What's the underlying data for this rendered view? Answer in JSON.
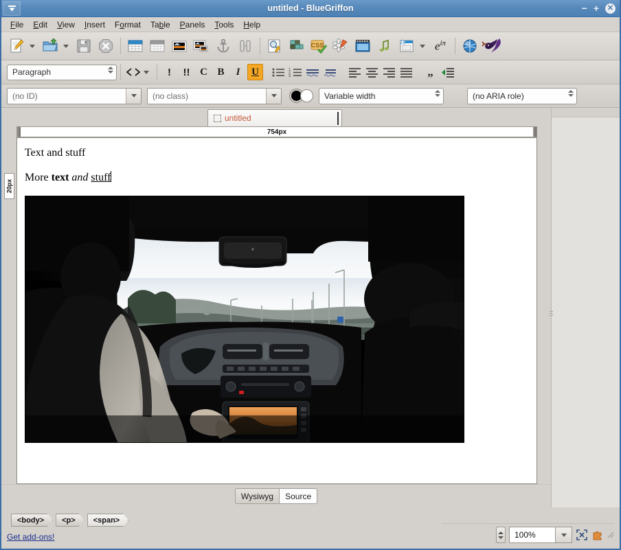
{
  "window": {
    "title": "untitled - BlueGriffon",
    "menu_icon": "window-menu-caret-icon",
    "minimize": "−",
    "maximize": "+",
    "close": "✕"
  },
  "menubar": {
    "items": [
      {
        "label": "File",
        "accel": "F"
      },
      {
        "label": "Edit",
        "accel": "E"
      },
      {
        "label": "View",
        "accel": "V"
      },
      {
        "label": "Insert",
        "accel": "I"
      },
      {
        "label": "Format",
        "accel": "o"
      },
      {
        "label": "Table",
        "accel": "b"
      },
      {
        "label": "Panels",
        "accel": "P"
      },
      {
        "label": "Tools",
        "accel": "T"
      },
      {
        "label": "Help",
        "accel": "H"
      }
    ]
  },
  "toolbar_main": {
    "items": [
      {
        "name": "new-document-icon",
        "kind": "button"
      },
      {
        "name": "new-document-dropdown-icon",
        "kind": "arrow"
      },
      {
        "name": "open-file-icon",
        "kind": "button"
      },
      {
        "name": "open-file-dropdown-icon",
        "kind": "arrow"
      },
      {
        "name": "save-icon",
        "kind": "button"
      },
      {
        "name": "cancel-icon",
        "kind": "button"
      },
      {
        "name": "insert-table-icon",
        "kind": "button"
      },
      {
        "name": "table-properties-icon",
        "kind": "button"
      },
      {
        "name": "insert-image-icon",
        "kind": "button"
      },
      {
        "name": "image-properties-icon",
        "kind": "button"
      },
      {
        "name": "anchor-icon",
        "kind": "button"
      },
      {
        "name": "link-icon",
        "kind": "button"
      },
      {
        "name": "preview-icon",
        "kind": "button"
      },
      {
        "name": "blocks-icon",
        "kind": "button"
      },
      {
        "name": "css-icon",
        "kind": "button"
      },
      {
        "name": "svg-icon",
        "kind": "button"
      },
      {
        "name": "video-icon",
        "kind": "button"
      },
      {
        "name": "audio-icon",
        "kind": "button"
      },
      {
        "name": "form-icon",
        "kind": "button"
      },
      {
        "name": "form-dropdown-icon",
        "kind": "arrow"
      },
      {
        "name": "math-icon",
        "kind": "button"
      },
      {
        "name": "browse-icon",
        "kind": "button"
      },
      {
        "name": "bluegriffon-logo-icon",
        "kind": "button"
      }
    ]
  },
  "toolbar_format": {
    "paragraph_style": "Paragraph",
    "buttons": [
      {
        "name": "code-tag-icon",
        "glyph": "‹›"
      },
      {
        "name": "code-tag-dropdown-icon",
        "glyph": ""
      },
      {
        "name": "emphasis-icon",
        "glyph": "!"
      },
      {
        "name": "strong-emphasis-icon",
        "glyph": "!!"
      },
      {
        "name": "cite-icon",
        "glyph": "C"
      },
      {
        "name": "bold-icon",
        "glyph": "B"
      },
      {
        "name": "italic-icon",
        "glyph": "I"
      },
      {
        "name": "underline-icon",
        "glyph": "U"
      },
      {
        "name": "bullet-list-icon",
        "glyph": ""
      },
      {
        "name": "numbered-list-icon",
        "glyph": ""
      },
      {
        "name": "outdent-icon",
        "glyph": ""
      },
      {
        "name": "indent-icon",
        "glyph": ""
      },
      {
        "name": "align-left-icon",
        "glyph": ""
      },
      {
        "name": "align-center-icon",
        "glyph": ""
      },
      {
        "name": "align-right-icon",
        "glyph": ""
      },
      {
        "name": "align-justify-icon",
        "glyph": ""
      },
      {
        "name": "blockquote-icon",
        "glyph": ""
      },
      {
        "name": "insert-indent-icon",
        "glyph": ""
      }
    ],
    "active_button": "underline-icon",
    "active_color": "#f5a623"
  },
  "toolbar_attrs": {
    "id_value": "(no ID)",
    "class_value": "(no class)",
    "foreground_color": "#000000",
    "background_color": "#ffffff",
    "font_value": "Variable width",
    "aria_value": "(no ARIA role)"
  },
  "document_tab": {
    "label": "untitled",
    "favicon": "blank-favicon-icon"
  },
  "rulers": {
    "horizontal_label": "754px",
    "vertical_label": "20px"
  },
  "content": {
    "paragraph1": "Text and stuff",
    "paragraph2": {
      "plain1": "More ",
      "bold": "text",
      "plain2": " ",
      "italic": "and",
      "plain3": " ",
      "underline": "stuff"
    },
    "image": {
      "name": "car-interior-photo",
      "description": "View from rear seat of a car through the windshield at a bright overcast sky over a highway"
    }
  },
  "view_tabs": {
    "wysiwyg": "Wysiwyg",
    "source": "Source",
    "active": "Source"
  },
  "breadcrumb": {
    "items": [
      "<body>",
      "<p>",
      "<span>"
    ]
  },
  "status": {
    "addons_link": "Get add-ons!",
    "zoom_value": "100%",
    "fullscreen_icon": "fullscreen-icon",
    "addons_icon": "puzzle-piece-icon",
    "resize_grip": "resize-grip-icon"
  }
}
